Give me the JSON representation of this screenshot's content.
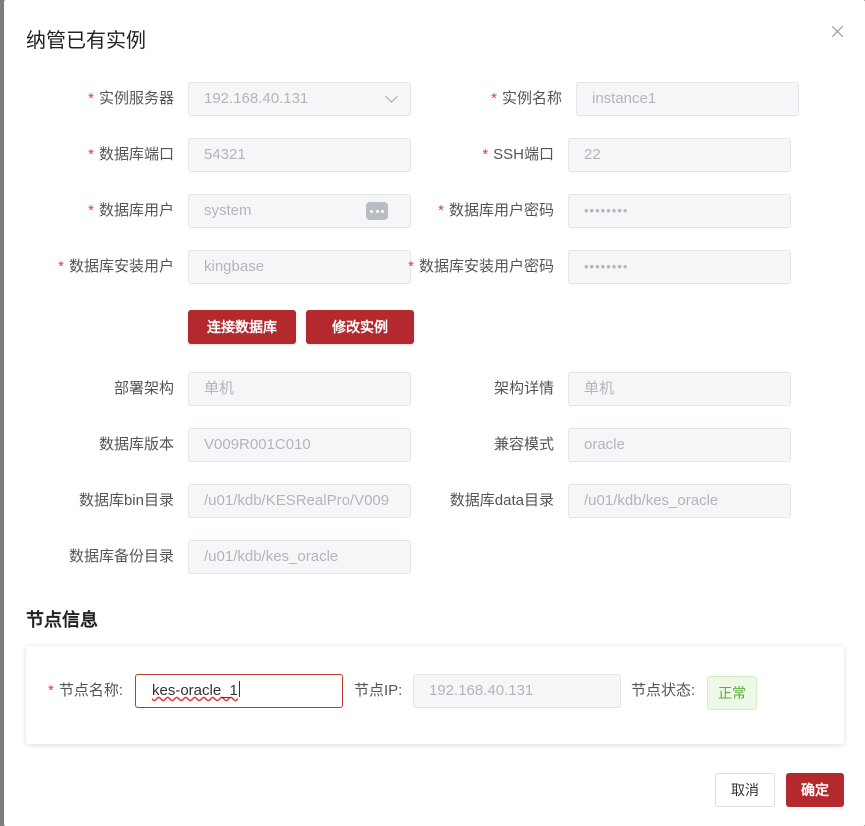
{
  "dialog": {
    "title": "纳管已有实例"
  },
  "form": {
    "required_mark": "*",
    "instance_server_label": "实例服务器",
    "instance_server_value": "192.168.40.131",
    "instance_name_label": "实例名称",
    "instance_name_value": "instance1",
    "db_port_label": "数据库端口",
    "db_port_value": "54321",
    "ssh_port_label": "SSH端口",
    "ssh_port_value": "22",
    "db_user_label": "数据库用户",
    "db_user_value": "system",
    "db_user_password_label": "数据库用户密码",
    "db_user_password_value": "••••••••",
    "install_user_label": "数据库安装用户",
    "install_user_value": "kingbase",
    "install_user_password_label": "数据库安装用户密码",
    "install_user_password_value": "••••••••",
    "connect_button": "连接数据库",
    "modify_button": "修改实例",
    "deploy_arch_label": "部署架构",
    "deploy_arch_value": "单机",
    "arch_detail_label": "架构详情",
    "arch_detail_value": "单机",
    "db_version_label": "数据库版本",
    "db_version_value": "V009R001C010",
    "compat_mode_label": "兼容模式",
    "compat_mode_value": "oracle",
    "bin_dir_label": "数据库bin目录",
    "bin_dir_value": "/u01/kdb/KESRealPro/V009",
    "data_dir_label": "数据库data目录",
    "data_dir_value": "/u01/kdb/kes_oracle",
    "backup_dir_label": "数据库备份目录",
    "backup_dir_value": "/u01/kdb/kes_oracle"
  },
  "node_section": {
    "title": "节点信息",
    "name_label": "节点名称:",
    "name_value": "kes-oracle_1",
    "ip_label": "节点IP:",
    "ip_value": "192.168.40.131",
    "status_label": "节点状态:",
    "status_value": "正常",
    "status_color": "#5cad3c"
  },
  "footer": {
    "cancel_label": "取消",
    "ok_label": "确定"
  },
  "colors": {
    "accent": "#b3292d",
    "required": "#e53935"
  }
}
